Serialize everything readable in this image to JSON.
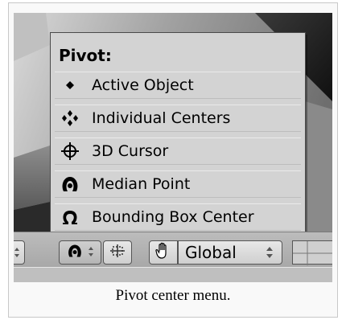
{
  "menu": {
    "title": "Pivot:",
    "items": [
      {
        "label": "Active Object",
        "icon": "dot-icon"
      },
      {
        "label": "Individual Centers",
        "icon": "individual-centers-icon"
      },
      {
        "label": "3D Cursor",
        "icon": "crosshair-cursor-icon"
      },
      {
        "label": "Median Point",
        "icon": "median-point-icon"
      },
      {
        "label": "Bounding Box Center",
        "icon": "bounding-box-icon"
      }
    ]
  },
  "header": {
    "orientation_value": "Global"
  },
  "caption": "Pivot center menu."
}
